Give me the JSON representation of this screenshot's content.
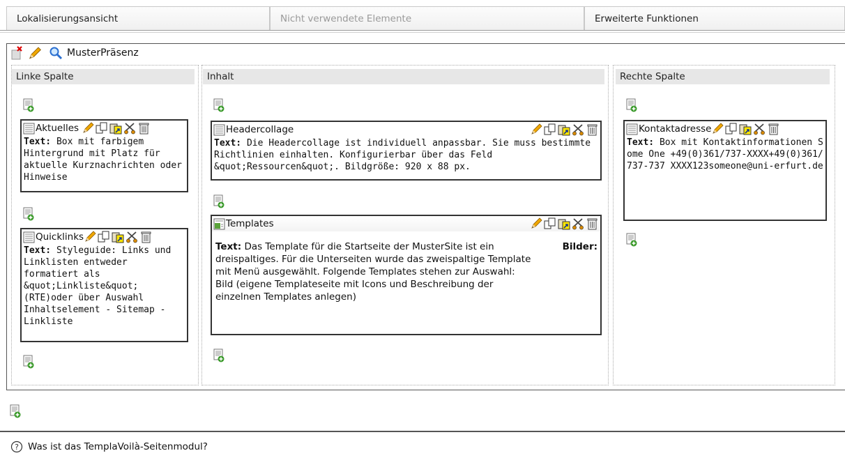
{
  "tabs": [
    {
      "label": "Lokalisierungsansicht",
      "active": true
    },
    {
      "label": "Nicht verwendete Elemente",
      "active": false
    },
    {
      "label": "Erweiterte Funktionen",
      "active": false
    }
  ],
  "page": {
    "title": "MusterPräsenz"
  },
  "columns": {
    "left": {
      "title": "Linke Spalte"
    },
    "center": {
      "title": "Inhalt"
    },
    "right": {
      "title": "Rechte Spalte"
    }
  },
  "elements": {
    "aktuelles": {
      "title": "Aktuelles",
      "label": "Text:",
      "body": "Box mit farbigem Hintergrund mit Platz für aktuelle Kurznachrichten oder Hinweise"
    },
    "quicklinks": {
      "title": "Quicklinks",
      "label": "Text:",
      "body": "Styleguide: Links und Linklisten entweder formatiert als &quot;Linkliste&quot; (RTE)oder über Auswahl Inhaltselement - Sitemap - Linkliste"
    },
    "headercollage": {
      "title": "Headercollage",
      "label": "Text:",
      "body": "Die Headercollage ist individuell anpassbar. Sie muss bestimmte Richtlinien einhalten. Konfigurierbar über das Feld &quot;Ressourcen&quot;. Bildgröße: 920 x 88 px."
    },
    "templates": {
      "title": "Templates",
      "label": "Text:",
      "body": "Das Template für die Startseite der MusterSite ist ein dreispaltiges. Für die Unterseiten wurde das zweispaltige Template mit Menü ausgewählt. Folgende Templates stehen zur Auswahl: Bild (eigene Templateseite mit Icons und Beschreibung der einzelnen Templates anlegen)",
      "side_label": "Bilder:"
    },
    "kontaktadresse": {
      "title": "Kontaktadresse",
      "label": "Text:",
      "body": "Box mit Kontaktinformationen Some One +49(0)361/737-XXXX+49(0)361/737-737 XXXX123someone@uni-erfurt.de"
    }
  },
  "help": {
    "text": "Was ist das TemplaVoilà-Seitenmodul?"
  },
  "colors": {
    "border": "#333333",
    "header_bg": "#e7e7e7",
    "pencil": "#f0a800",
    "scissors": "#d98a00"
  }
}
